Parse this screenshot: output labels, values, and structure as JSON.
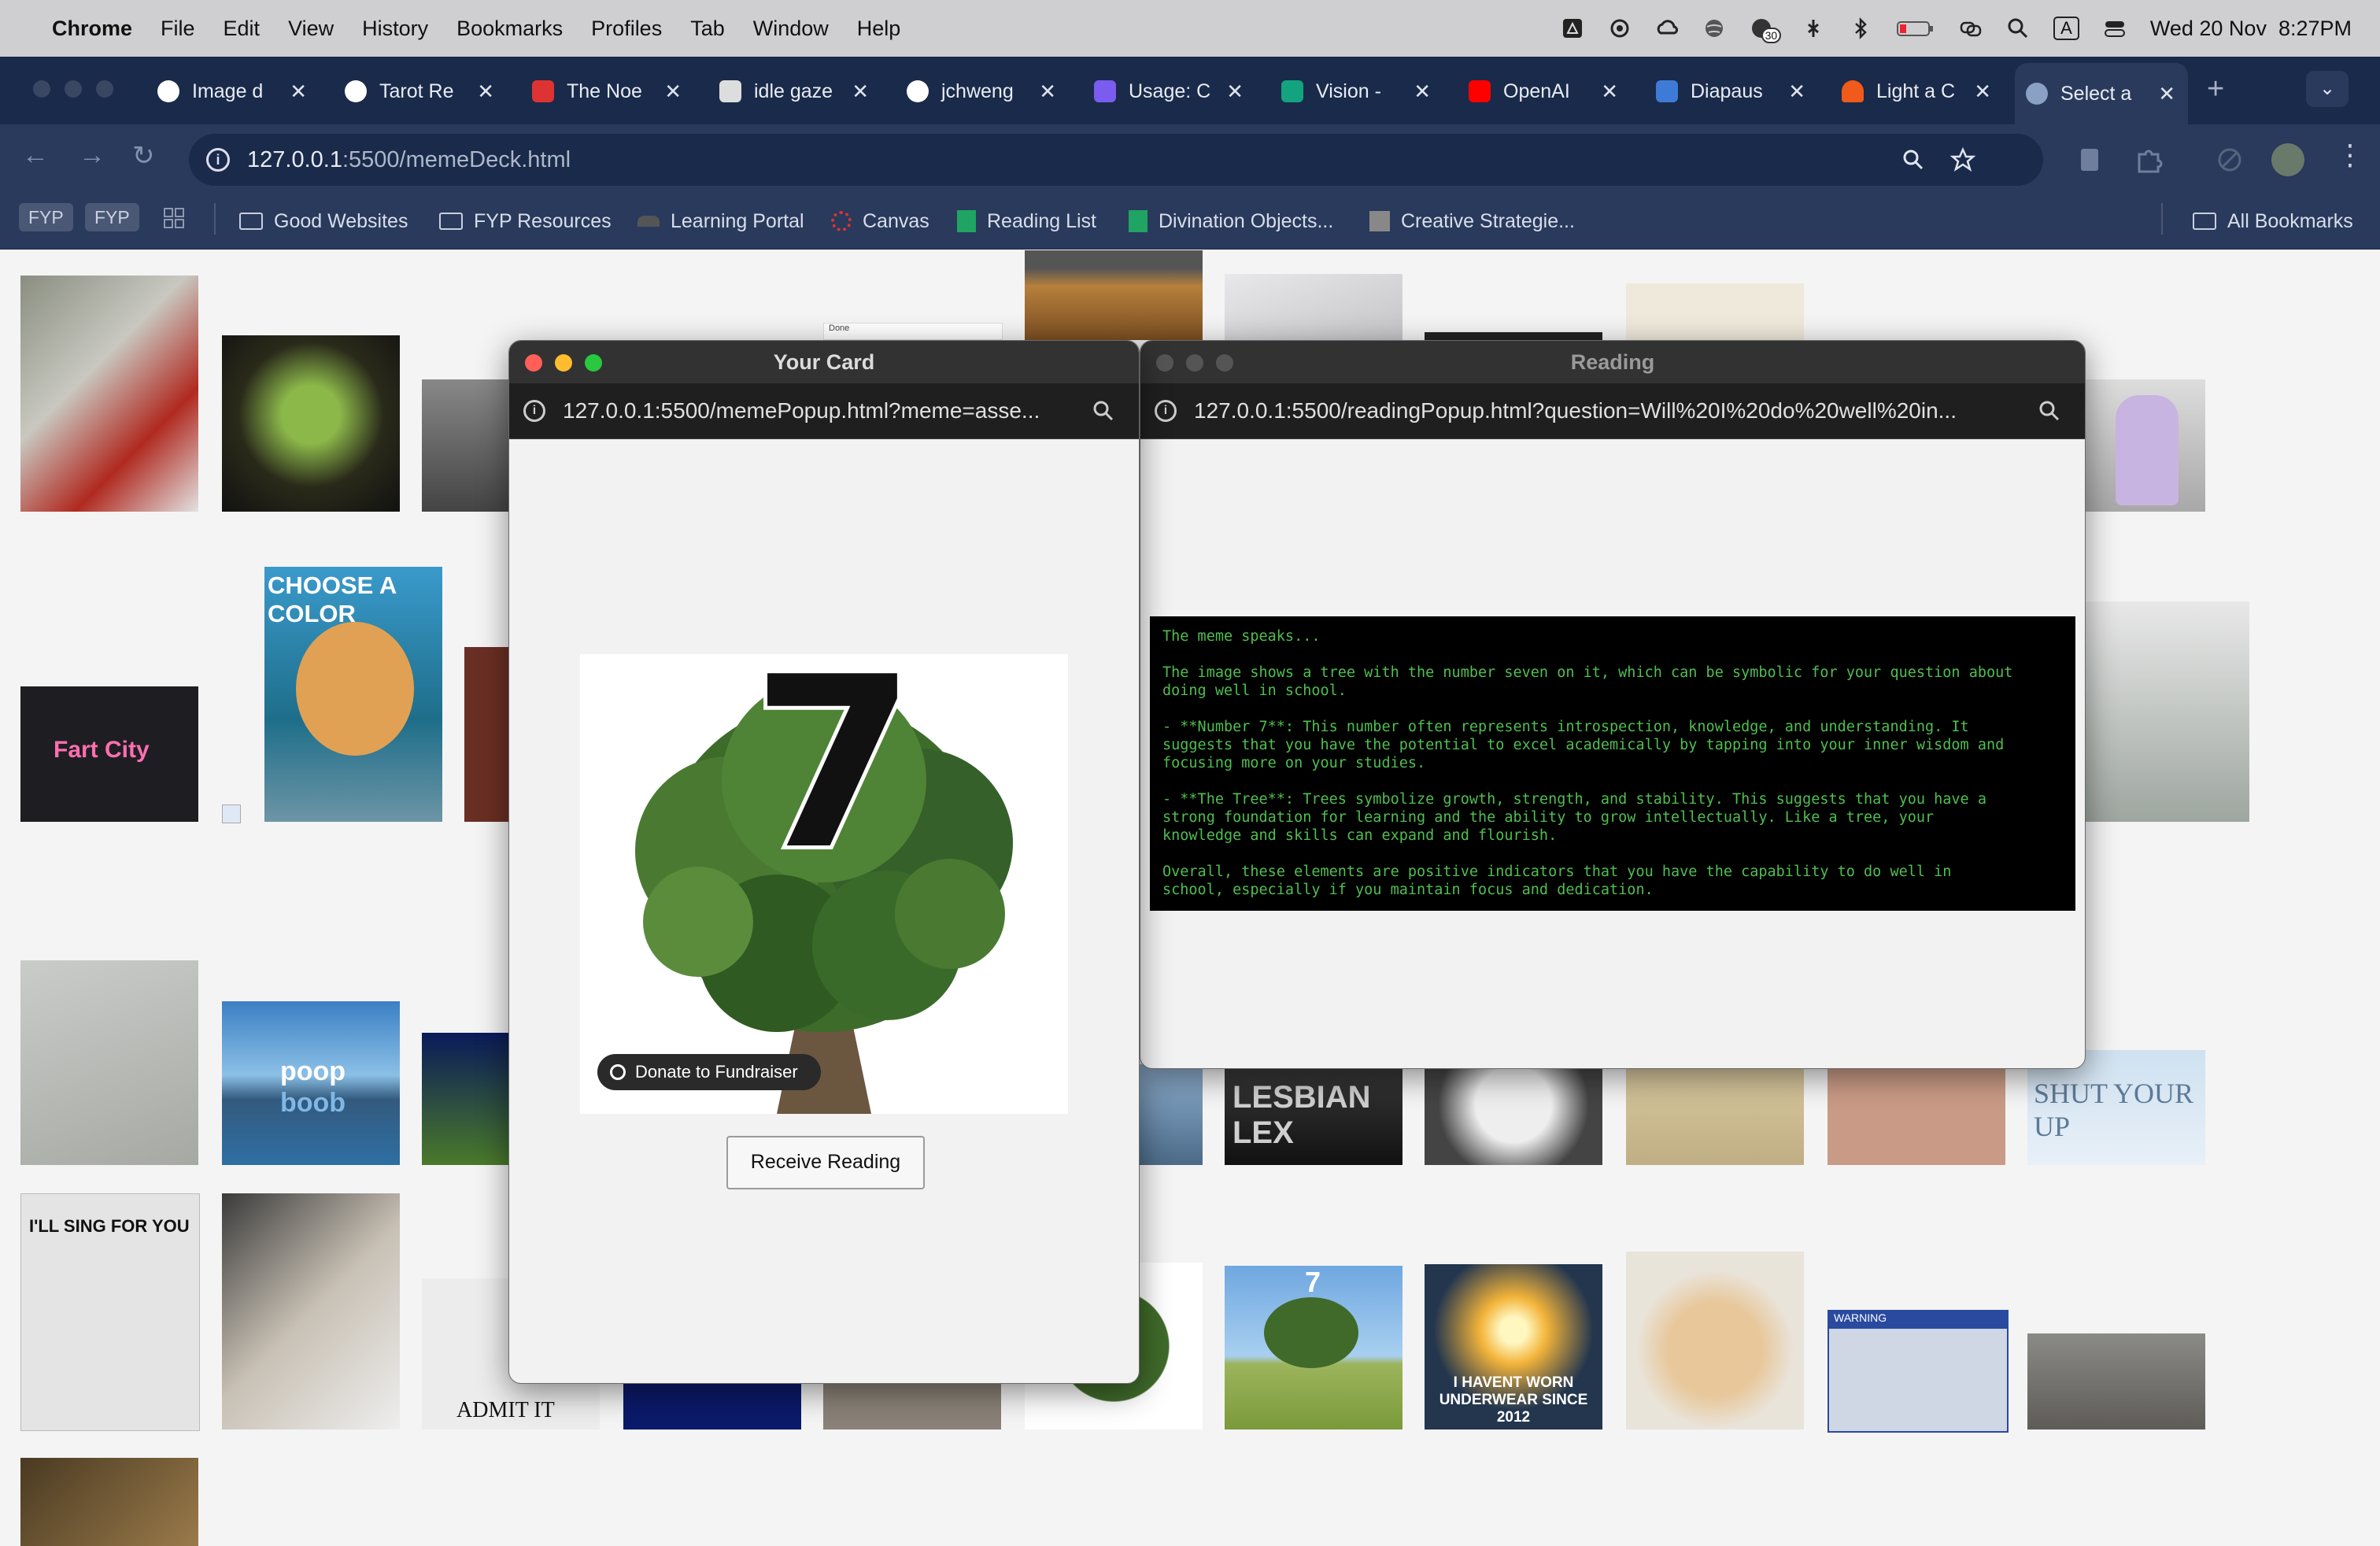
{
  "menubar": {
    "app": "Chrome",
    "items": [
      "File",
      "Edit",
      "View",
      "History",
      "Bookmarks",
      "Profiles",
      "Tab",
      "Window",
      "Help"
    ],
    "datetime": "Wed 20 Nov  8:27PM",
    "badge": "30",
    "input_indicator": "A"
  },
  "tabs": [
    {
      "label": "Image d",
      "icon": "openai-icon"
    },
    {
      "label": "Tarot Re",
      "icon": "openai-icon"
    },
    {
      "label": "The Noe",
      "icon": "cb-icon"
    },
    {
      "label": "idle gaze",
      "icon": "lines-icon"
    },
    {
      "label": "jchweng",
      "icon": "github-icon"
    },
    {
      "label": "Usage: C",
      "icon": "usage-icon"
    },
    {
      "label": "Vision -",
      "icon": "vision-icon"
    },
    {
      "label": "OpenAI",
      "icon": "youtube-icon"
    },
    {
      "label": "Diapaus",
      "icon": "butterfly-icon"
    },
    {
      "label": "Light a C",
      "icon": "fire-icon"
    },
    {
      "label": "Select a",
      "icon": "globe-icon"
    }
  ],
  "address": {
    "host": "127.0.0.1",
    "rest": ":5500/memeDeck.html"
  },
  "bookmarks": {
    "chips": [
      "FYP",
      "FYP"
    ],
    "items": [
      "Good Websites",
      "FYP Resources",
      "Learning Portal",
      "Canvas",
      "Reading List",
      "Divination Objects...",
      "Creative Strategie..."
    ],
    "all": "All Bookmarks"
  },
  "page_thumbs": {
    "choose_color": "CHOOSE A COLOR",
    "fart_city": "Fart City",
    "poop": "poop",
    "boob": "boob",
    "sing": "I'LL SING FOR YOU",
    "admit": "ADMIT IT",
    "lex": "LESBIAN LEX",
    "shut": "SHUT YOUR UP",
    "havent": "I HAVENT WORN UNDERWEAR SINCE 2012",
    "tree7": "7",
    "warning": "WARNING",
    "done": "Done"
  },
  "card_popup": {
    "title": "Your Card",
    "url": "127.0.0.1:5500/memePopup.html?meme=asse...",
    "card_number": "7",
    "donate": "Donate to Fundraiser",
    "button": "Receive Reading"
  },
  "reading_popup": {
    "title": "Reading",
    "url": "127.0.0.1:5500/readingPopup.html?question=Will%20I%20do%20well%20in...",
    "text": "The meme speaks...\n\nThe image shows a tree with the number seven on it, which can be symbolic for your question about\ndoing well in school.\n\n- **Number 7**: This number often represents introspection, knowledge, and understanding. It\nsuggests that you have the potential to excel academically by tapping into your inner wisdom and\nfocusing more on your studies.\n\n- **The Tree**: Trees symbolize growth, strength, and stability. This suggests that you have a\nstrong foundation for learning and the ability to grow intellectually. Like a tree, your\nknowledge and skills can expand and flourish.\n\nOverall, these elements are positive indicators that you have the capability to do well in\nschool, especially if you maintain focus and dedication."
  }
}
